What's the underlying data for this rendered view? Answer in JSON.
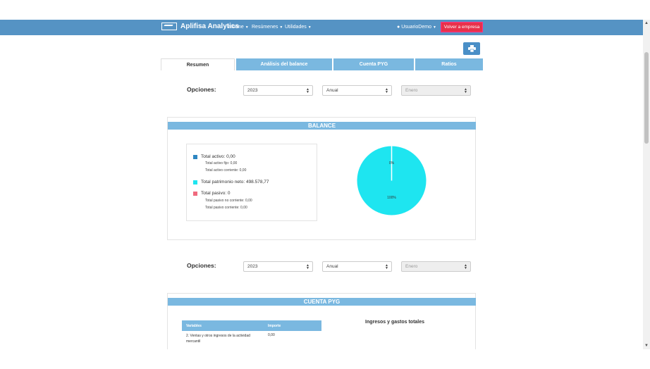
{
  "navbar": {
    "brand": "Aplifisa Analytics",
    "menu": [
      {
        "label": "Informe"
      },
      {
        "label": "Resúmenes"
      },
      {
        "label": "Utilidades"
      }
    ],
    "user": "UsuarioDemo",
    "volver_label": "Volver a empresa",
    "color": "#5593c4"
  },
  "tabs": [
    {
      "label": "Resumen",
      "active": true
    },
    {
      "label": "Análisis del balance",
      "active": false
    },
    {
      "label": "Cuenta PYG",
      "active": false
    },
    {
      "label": "Ratios",
      "active": false
    }
  ],
  "opciones_1": {
    "label": "Opciones:",
    "year": "2023",
    "period": "Anual",
    "month": "Enero"
  },
  "balance": {
    "title": "BALANCE",
    "legend": [
      {
        "label": "Total activo: 0,00",
        "color": "#2e86c1"
      },
      {
        "label": "Total activo fijo: 0,00"
      },
      {
        "label": "Total activo corriente: 0,00"
      },
      {
        "label": "Total patrimonio neto: 498.578,77",
        "color": "#1ee5f0"
      },
      {
        "label": "Total pasivo: 0",
        "color": "#f06a7e"
      },
      {
        "label": "Total pasivo no corriente: 0,00"
      },
      {
        "label": "Total pasivo corriente: 0,00"
      }
    ]
  },
  "chart_data": {
    "type": "pie",
    "categories": [
      "Total activo",
      "Total patrimonio neto",
      "Total pasivo"
    ],
    "values": [
      0,
      100,
      0
    ],
    "labels": [
      "0%",
      "100%"
    ],
    "colors": [
      "#2e86c1",
      "#1ee5f0",
      "#f06a7e"
    ]
  },
  "opciones_2": {
    "label": "Opciones:",
    "year": "2023",
    "period": "Anual",
    "month": "Enero"
  },
  "pyg": {
    "title": "CUENTA PYG",
    "subtitle": "Ingresos y gastos totales",
    "columns": [
      "Variables",
      "Importe"
    ],
    "rows": [
      {
        "variable": "2. Ventas y otros ingresos de la actividad mercantil",
        "importe": "0,00"
      }
    ]
  }
}
